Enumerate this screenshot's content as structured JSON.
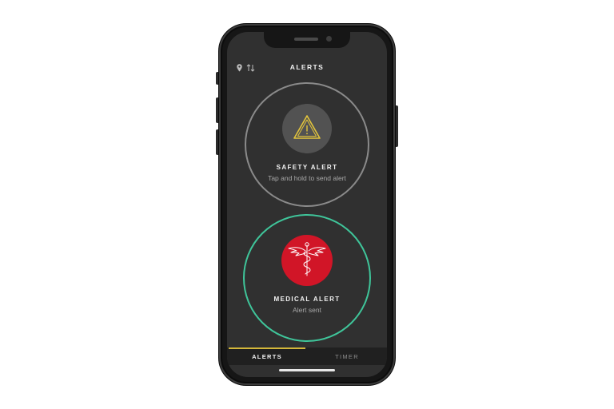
{
  "header": {
    "title": "ALERTS",
    "icons": [
      "location-pin-icon",
      "sort-arrows-icon"
    ]
  },
  "safety_alert": {
    "title": "SAFETY ALERT",
    "subtitle": "Tap and hold to send alert",
    "icon": "warning-triangle-icon",
    "ring_color": "#8a8a8a",
    "icon_color": "#e3c53c"
  },
  "medical_alert": {
    "title": "MEDICAL ALERT",
    "subtitle": "Alert sent",
    "icon": "caduceus-icon",
    "ring_color": "#3fc59a",
    "badge_color": "#d11527"
  },
  "tabs": [
    {
      "label": "ALERTS",
      "active": true
    },
    {
      "label": "TIMER",
      "active": false
    }
  ],
  "colors": {
    "screen_bg": "#303030",
    "accent_tab": "#d4b73a"
  }
}
